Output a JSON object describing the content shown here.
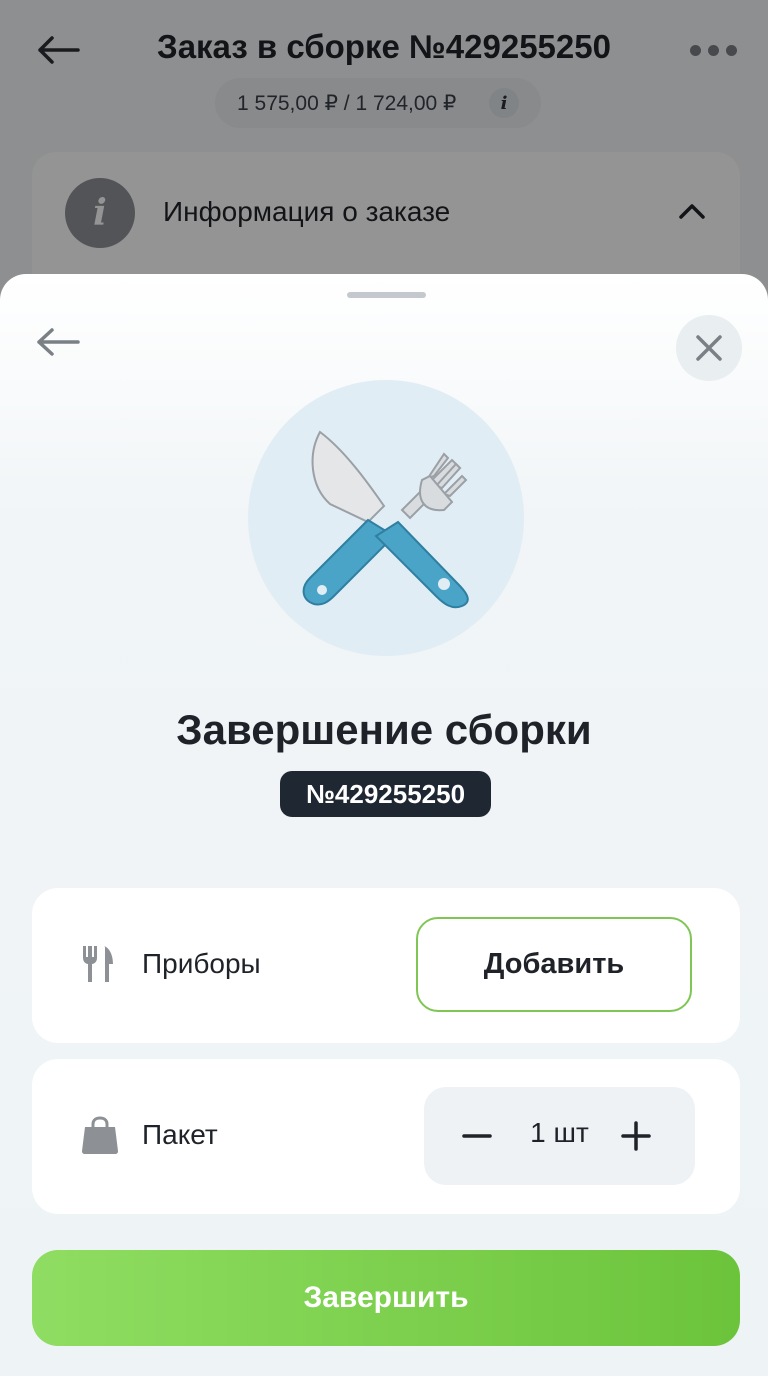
{
  "background": {
    "title": "Заказ в сборке №429255250",
    "price": "1 575,00 ₽ / 1 724,00 ₽",
    "info_card_label": "Информация о заказе"
  },
  "sheet": {
    "title": "Завершение сборки",
    "order_number": "№429255250",
    "cutlery": {
      "label": "Приборы",
      "add_label": "Добавить"
    },
    "bag": {
      "label": "Пакет",
      "quantity": "1 шт"
    },
    "finish_label": "Завершить"
  },
  "colors": {
    "accent_green": "#6cc43b",
    "badge_dark": "#1f2732",
    "hero_blue": "#4aa4c8"
  },
  "icons": [
    "back-arrow-icon",
    "more-icon",
    "info-icon",
    "chevron-up-icon",
    "close-icon",
    "cutlery-icon",
    "bag-icon",
    "minus-icon",
    "plus-icon"
  ]
}
